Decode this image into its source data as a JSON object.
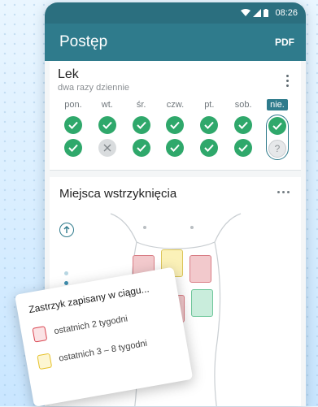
{
  "status": {
    "time": "08:26"
  },
  "appbar": {
    "title": "Postęp",
    "pdf_label": "PDF"
  },
  "medication": {
    "name": "Lek",
    "frequency": "dwa razy dziennie",
    "days": [
      {
        "label": "pon.",
        "doses": [
          "done",
          "done"
        ]
      },
      {
        "label": "wt.",
        "doses": [
          "done",
          "missed"
        ]
      },
      {
        "label": "śr.",
        "doses": [
          "done",
          "done"
        ]
      },
      {
        "label": "czw.",
        "doses": [
          "done",
          "done"
        ]
      },
      {
        "label": "pt.",
        "doses": [
          "done",
          "done"
        ]
      },
      {
        "label": "sob.",
        "doses": [
          "done",
          "done"
        ]
      },
      {
        "label": "nie.",
        "doses": [
          "done",
          "pending"
        ],
        "today": true
      }
    ]
  },
  "injection_sites": {
    "title": "Miejsca wstrzyknięcia",
    "zone_colors": {
      "red": "#f2c9cc",
      "yellow": "#fbf1b8",
      "green": "#c9eddc"
    }
  },
  "legend_toast": {
    "title": "Zastrzyk zapisany w ciągu...",
    "items": [
      {
        "label": "ostatnich 2 tygodni",
        "color": "#d9434f"
      },
      {
        "label": "ostatnich 3 – 8 tygodni",
        "color": "#e6c12b"
      }
    ]
  },
  "colors": {
    "primary": "#2f7b8c",
    "done": "#2fa86b"
  }
}
